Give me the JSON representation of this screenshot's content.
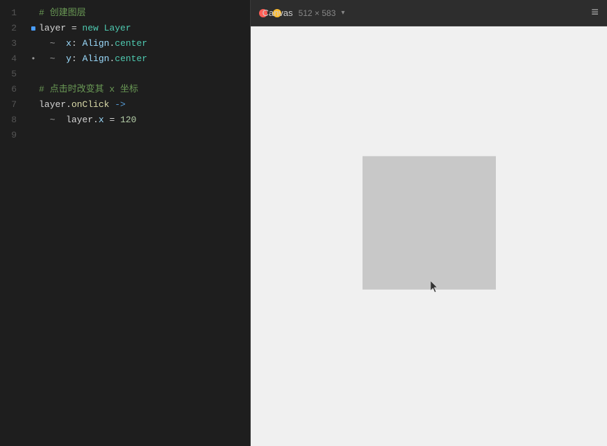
{
  "editor": {
    "lines": [
      {
        "num": 1,
        "indent": 0,
        "indicator": false,
        "content": "# 创建图层"
      },
      {
        "num": 2,
        "indent": 0,
        "indicator": true,
        "content": "layer = new Layer"
      },
      {
        "num": 3,
        "indent": 1,
        "indicator": false,
        "content": "  x: Align.center"
      },
      {
        "num": 4,
        "indent": 1,
        "indicator": true,
        "content": "  y: Align.center"
      },
      {
        "num": 5,
        "indent": 0,
        "indicator": false,
        "content": ""
      },
      {
        "num": 6,
        "indent": 0,
        "indicator": false,
        "content": "# 点击时改变其 x 坐标"
      },
      {
        "num": 7,
        "indent": 0,
        "indicator": false,
        "content": "layer.onClick ->"
      },
      {
        "num": 8,
        "indent": 1,
        "indicator": false,
        "content": "  layer.x = 120"
      },
      {
        "num": 9,
        "indent": 0,
        "indicator": false,
        "content": ""
      }
    ]
  },
  "canvas": {
    "title": "Canvas",
    "dimensions": "512 × 583",
    "chevron": "▾",
    "menu_icon": "≡"
  }
}
